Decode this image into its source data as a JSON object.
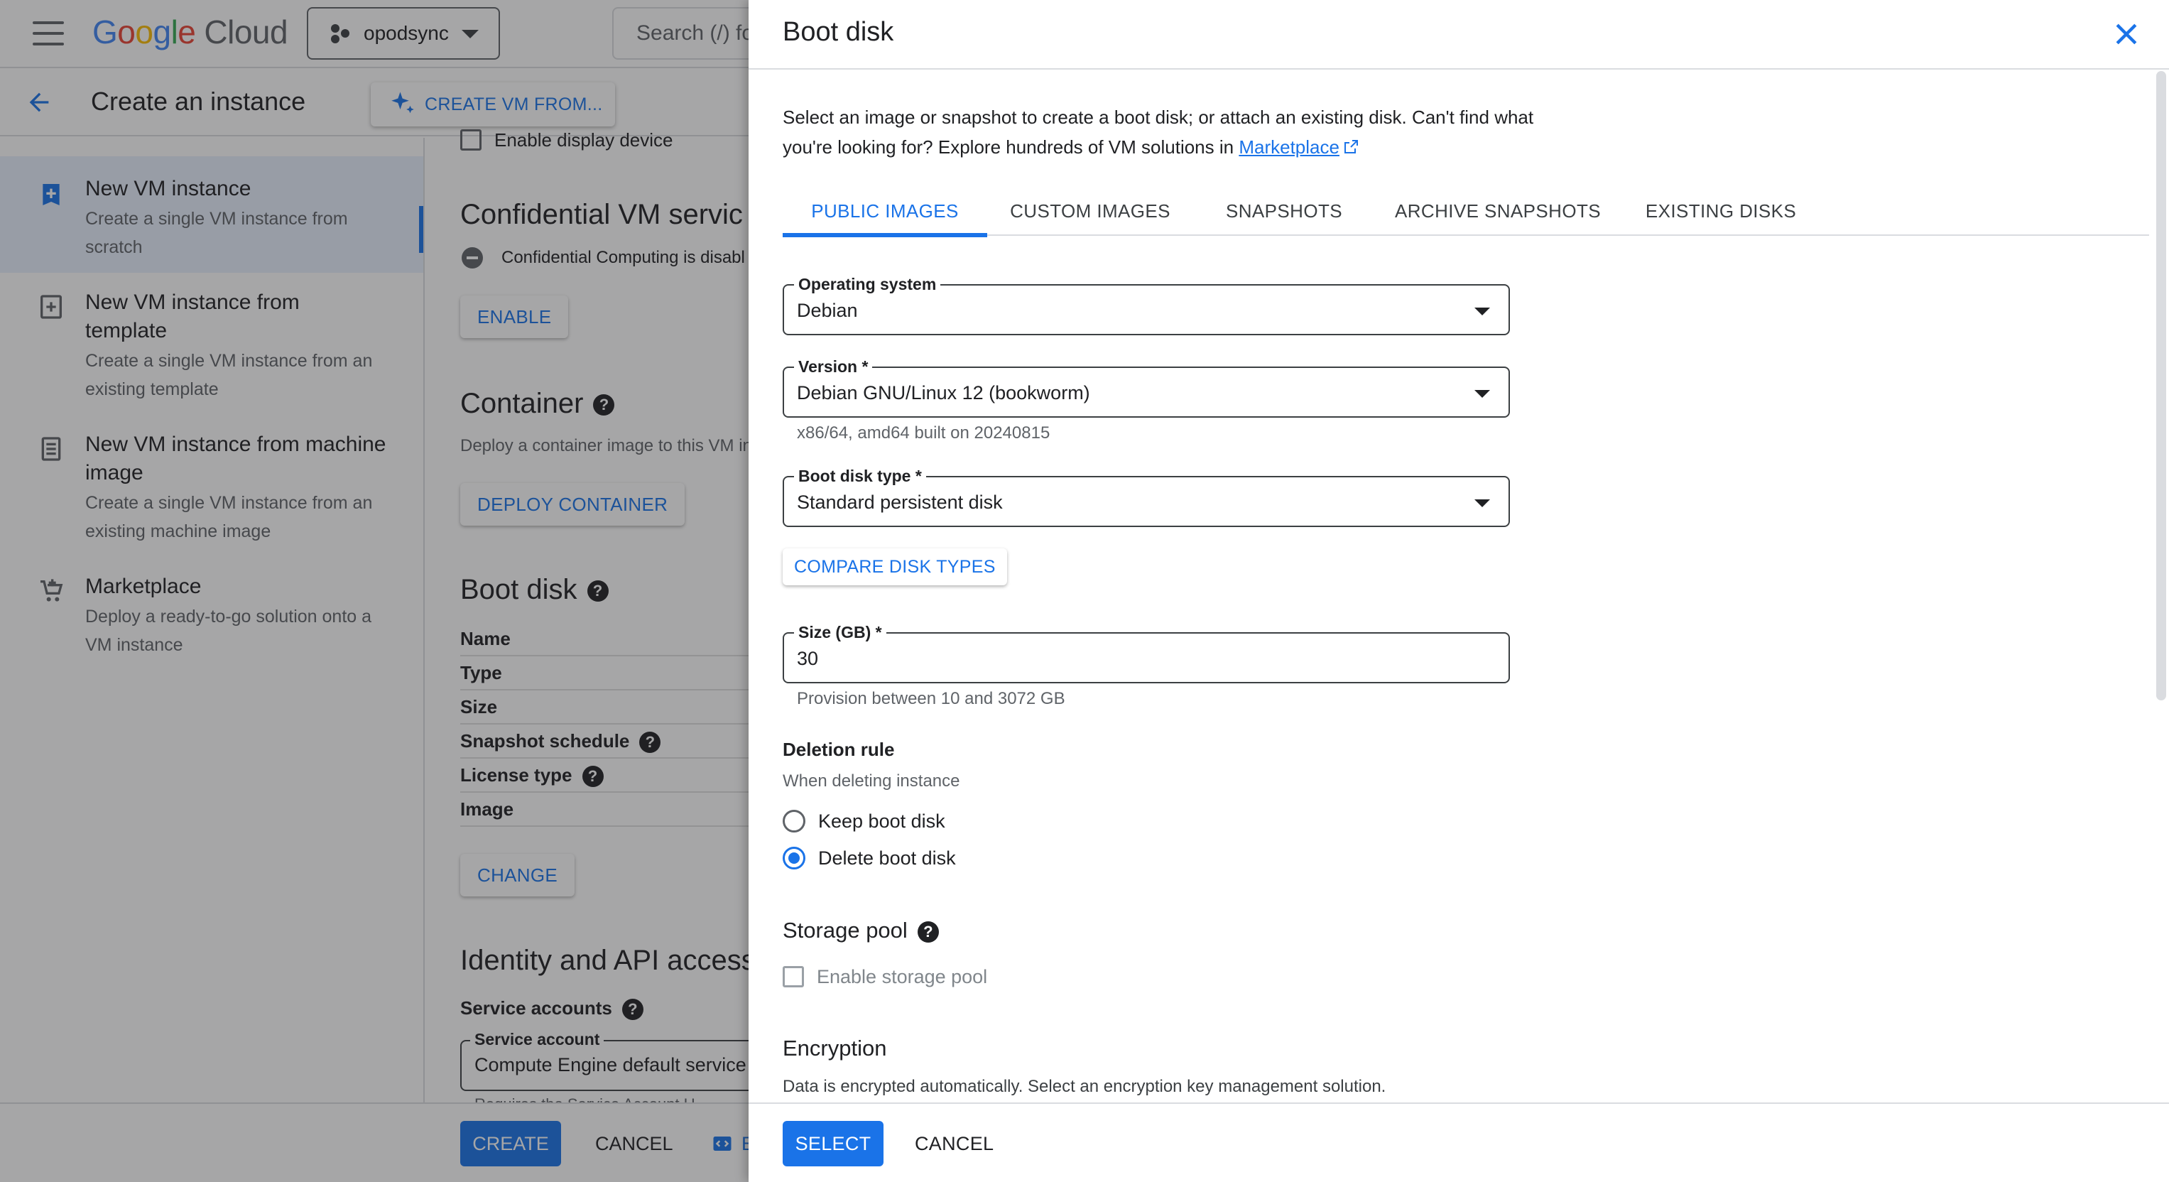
{
  "colors": {
    "accent": "#1a73e8",
    "scrim": "rgba(32,33,36,0.4)"
  },
  "topbar": {
    "logo_letters": [
      "G",
      "o",
      "o",
      "g",
      "l",
      "e"
    ],
    "logo_product": "Cloud",
    "project": "opodsync",
    "search_placeholder": "Search (/) fo"
  },
  "subbar": {
    "title": "Create an instance",
    "create_from_label": "CREATE VM FROM..."
  },
  "left_nav": {
    "items": [
      {
        "title": "New VM instance",
        "desc": "Create a single VM instance from scratch",
        "icon": "add-box-icon",
        "active": true
      },
      {
        "title": "New VM instance from template",
        "desc": "Create a single VM instance from an existing template",
        "icon": "template-icon",
        "active": false
      },
      {
        "title": "New VM instance from machine image",
        "desc": "Create a single VM instance from an existing machine image",
        "icon": "machine-image-icon",
        "active": false
      },
      {
        "title": "Marketplace",
        "desc": "Deploy a ready-to-go solution onto a VM instance",
        "icon": "cart-icon",
        "active": false
      }
    ]
  },
  "main": {
    "display_device": "Enable display device",
    "confidential_title": "Confidential VM servic",
    "confidential_text": "Confidential Computing is disabl",
    "enable_label": "ENABLE",
    "container_title": "Container",
    "container_text": "Deploy a container image to this VM in",
    "deploy_container_label": "DEPLOY CONTAINER",
    "boot_disk_title": "Boot disk",
    "boot_disk_rows": [
      "Name",
      "Type",
      "Size",
      "Snapshot schedule",
      "License type",
      "Image"
    ],
    "change_label": "CHANGE",
    "identity_title": "Identity and API access",
    "service_accounts_label": "Service accounts",
    "service_account_field_label": "Service account",
    "service_account_value": "Compute Engine default service a",
    "service_account_hint": "Requires the Service Account U"
  },
  "bottom": {
    "create_label": "CREATE",
    "cancel_label": "CANCEL",
    "code_label": "E"
  },
  "panel": {
    "title": "Boot disk",
    "intro": "Select an image or snapshot to create a boot disk; or attach an existing disk. Can't find what you're looking for? Explore hundreds of VM solutions in",
    "marketplace_link": "Marketplace",
    "tabs": [
      "PUBLIC IMAGES",
      "CUSTOM IMAGES",
      "SNAPSHOTS",
      "ARCHIVE SNAPSHOTS",
      "EXISTING DISKS"
    ],
    "active_tab": "PUBLIC IMAGES",
    "os_label": "Operating system",
    "os_value": "Debian",
    "version_label": "Version *",
    "version_value": "Debian GNU/Linux 12 (bookworm)",
    "version_hint": "x86/64, amd64 built on 20240815",
    "disk_type_label": "Boot disk type *",
    "disk_type_value": "Standard persistent disk",
    "compare_label": "COMPARE DISK TYPES",
    "size_label": "Size (GB) *",
    "size_value": "30",
    "size_hint": "Provision between 10 and 3072 GB",
    "deletion_title": "Deletion rule",
    "deletion_desc": "When deleting instance",
    "keep_label": "Keep boot disk",
    "delete_label": "Delete boot disk",
    "deletion_selected": "Delete boot disk",
    "storage_pool_title": "Storage pool",
    "storage_pool_checkbox": "Enable storage pool",
    "encryption_title": "Encryption",
    "encryption_desc": "Data is encrypted automatically. Select an encryption key management solution.",
    "select_label": "SELECT",
    "cancel_label": "CANCEL"
  }
}
